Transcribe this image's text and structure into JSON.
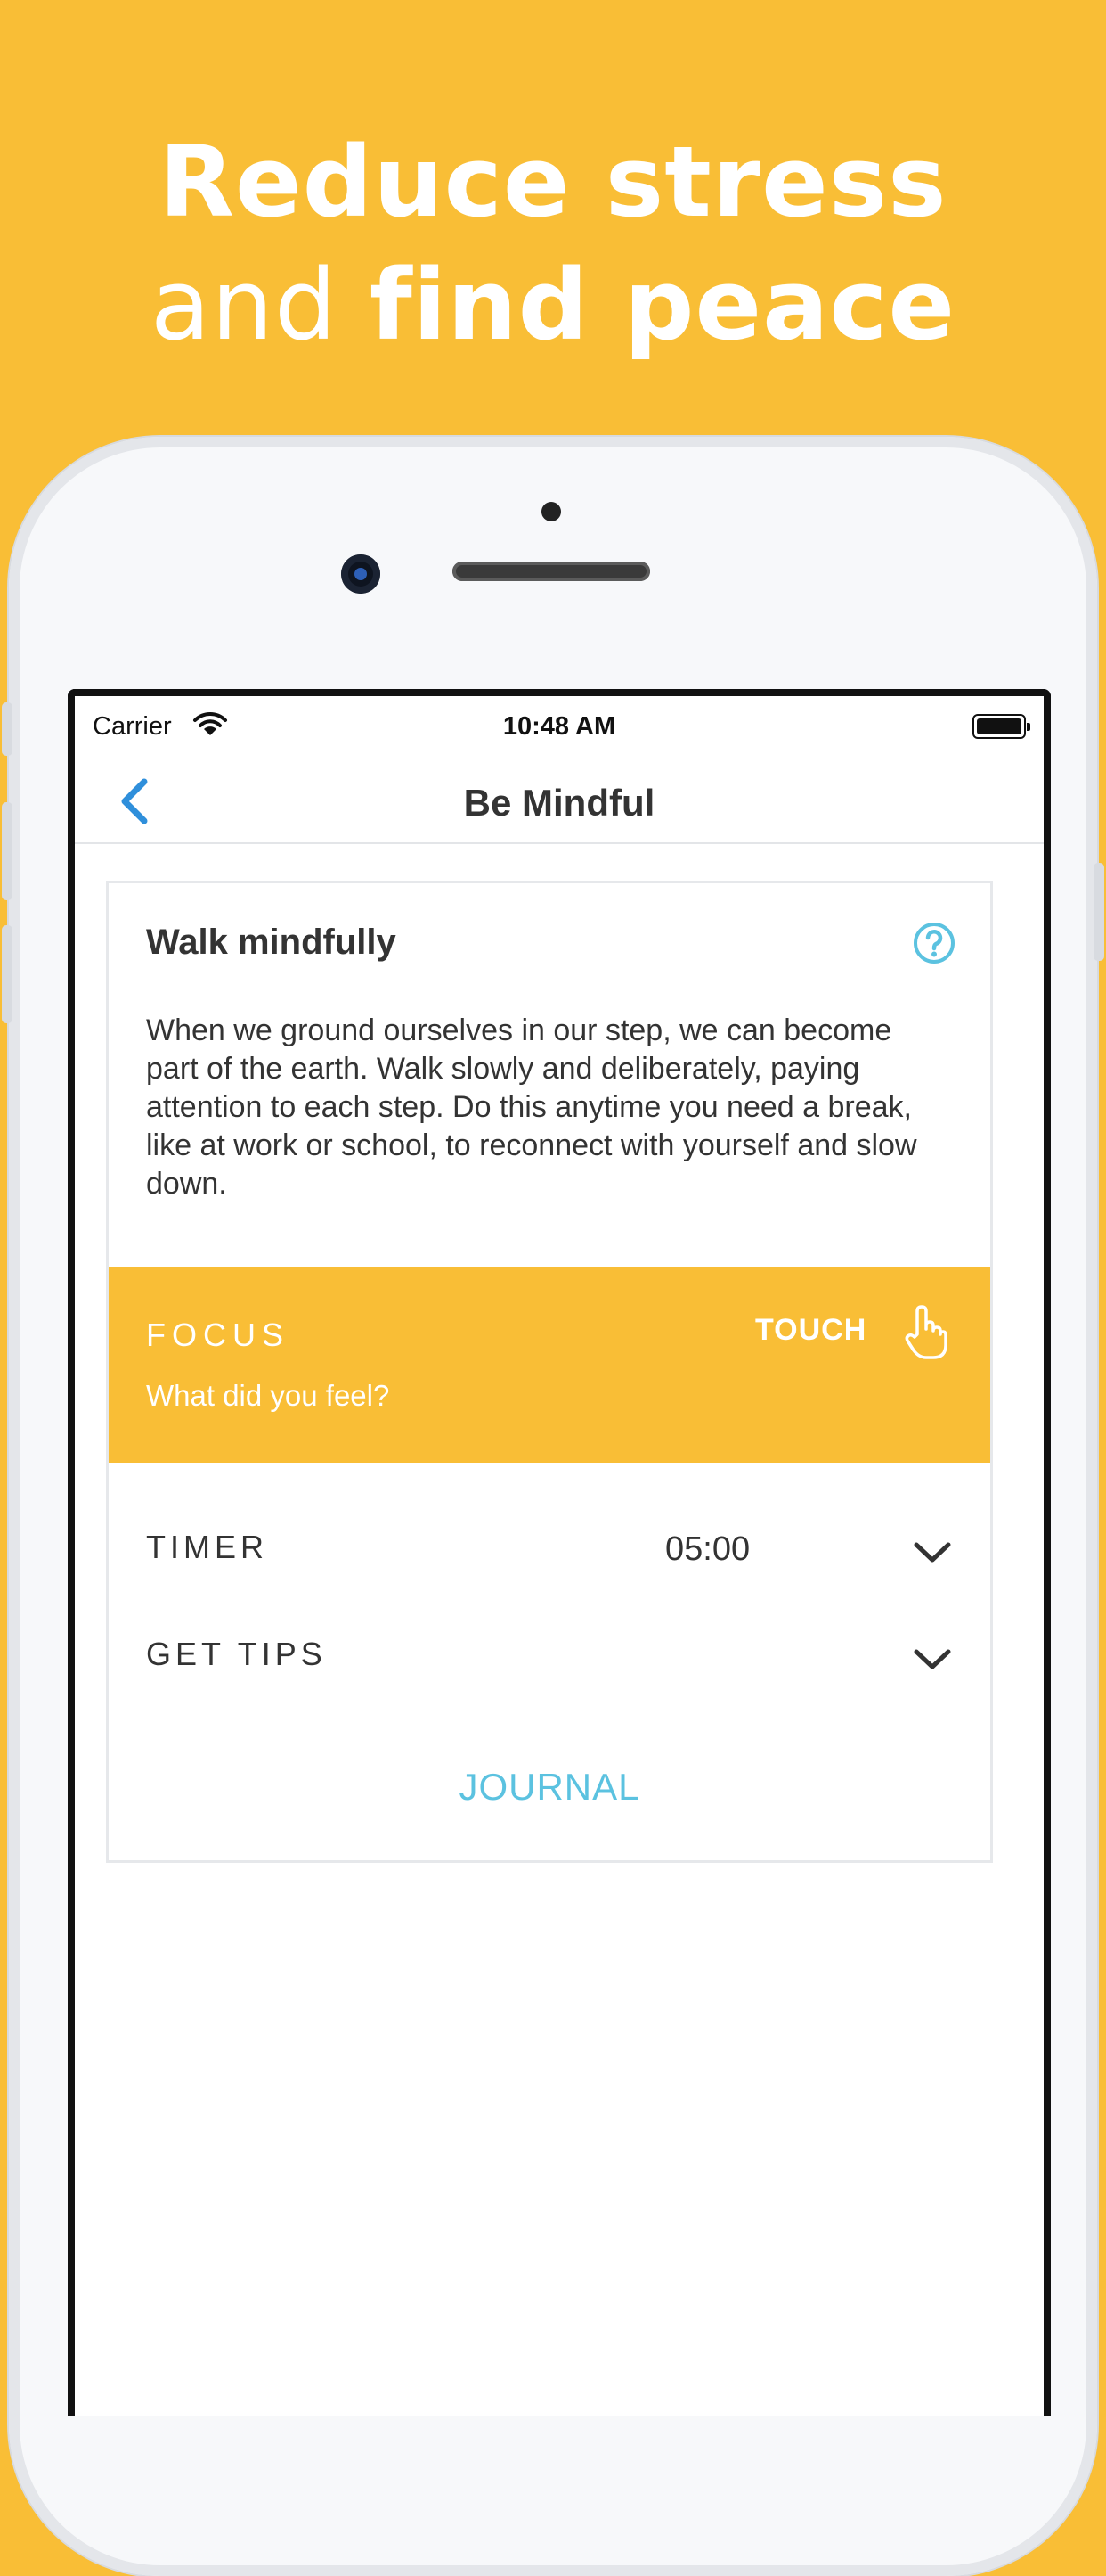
{
  "headline": {
    "line1": "Reduce stress",
    "line2_thin": "and",
    "line2_bold": "find peace"
  },
  "status_bar": {
    "carrier": "Carrier",
    "time": "10:48 AM"
  },
  "nav": {
    "title": "Be Mindful"
  },
  "card": {
    "heading": "Walk mindfully",
    "description": "When we ground ourselves in our step, we can become part of the earth. Walk slowly and deliberately, paying attention to each step. Do this anytime you need a break, like at work or school, to reconnect with yourself and slow down.",
    "focus": {
      "label": "FOCUS",
      "prompt": "What did you feel?",
      "action": "TOUCH"
    },
    "timer": {
      "label": "TIMER",
      "value": "05:00"
    },
    "tips": {
      "label": "GET TIPS"
    },
    "journal_label": "JOURNAL"
  },
  "colors": {
    "accent_yellow": "#F9BE36",
    "link_blue": "#5BC2E0",
    "back_blue": "#2F8FDB",
    "text_dark": "#333333"
  },
  "icons": [
    "wifi-icon",
    "battery-icon",
    "back-chevron-icon",
    "help-icon",
    "hand-pointer-icon",
    "chevron-down-icon"
  ]
}
